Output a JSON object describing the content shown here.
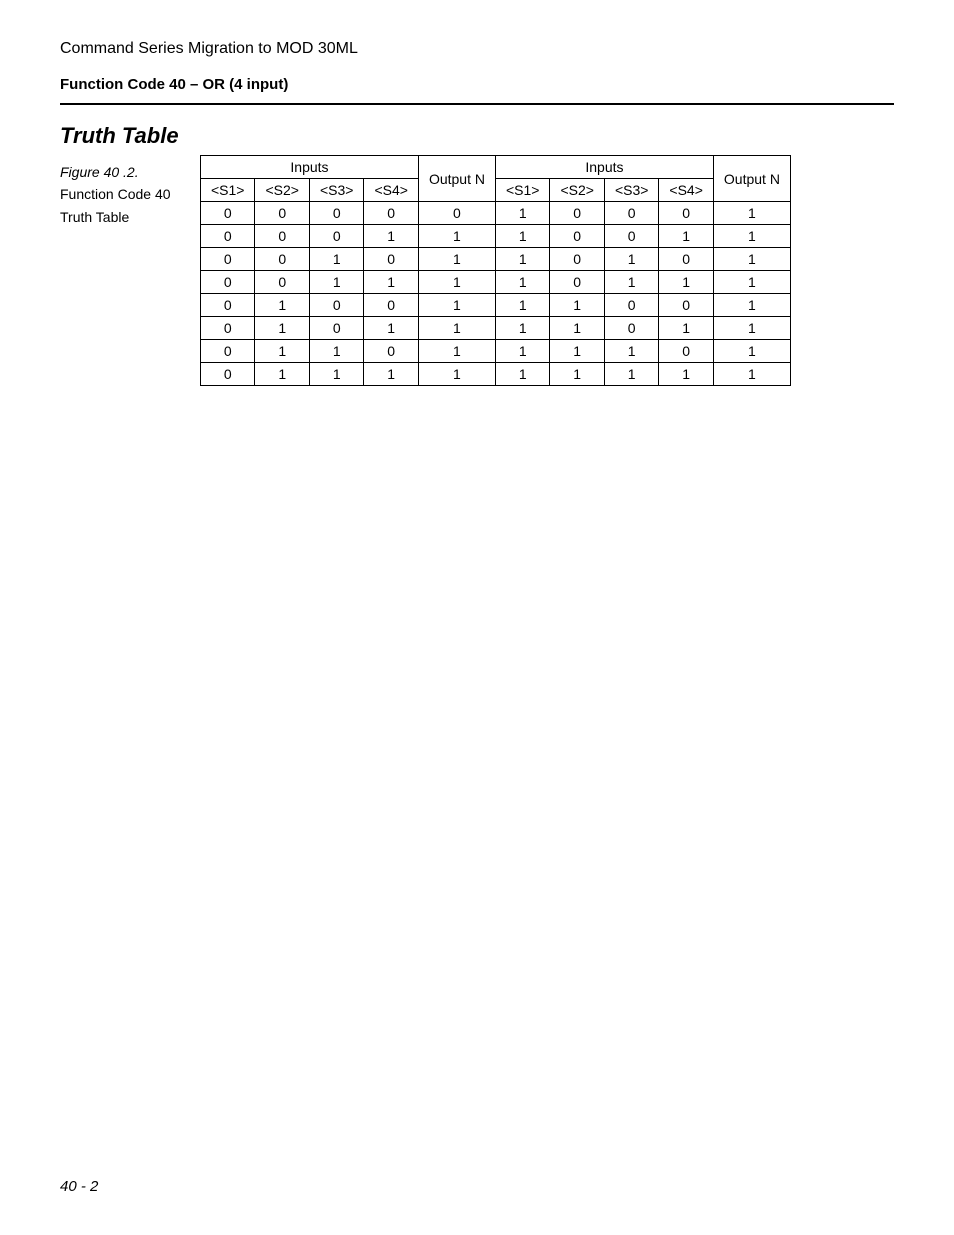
{
  "header": {
    "title": "Command Series Migration to MOD 30ML",
    "subtitle": "Function Code 40 – OR (4 input)"
  },
  "section": {
    "title": "Truth Table"
  },
  "figure": {
    "label": "Figure 40 .2.",
    "line1": "Function Code 40",
    "line2": "Truth Table"
  },
  "table": {
    "inputs_header": "Inputs",
    "output_header": "Output N",
    "sub_headers": [
      "<S1>",
      "<S2>",
      "<S3>",
      "<S4>"
    ],
    "rows_left": [
      [
        "0",
        "0",
        "0",
        "0",
        "0"
      ],
      [
        "0",
        "0",
        "0",
        "1",
        "1"
      ],
      [
        "0",
        "0",
        "1",
        "0",
        "1"
      ],
      [
        "0",
        "0",
        "1",
        "1",
        "1"
      ],
      [
        "0",
        "1",
        "0",
        "0",
        "1"
      ],
      [
        "0",
        "1",
        "0",
        "1",
        "1"
      ],
      [
        "0",
        "1",
        "1",
        "0",
        "1"
      ],
      [
        "0",
        "1",
        "1",
        "1",
        "1"
      ]
    ],
    "rows_right": [
      [
        "1",
        "0",
        "0",
        "0",
        "1"
      ],
      [
        "1",
        "0",
        "0",
        "1",
        "1"
      ],
      [
        "1",
        "0",
        "1",
        "0",
        "1"
      ],
      [
        "1",
        "0",
        "1",
        "1",
        "1"
      ],
      [
        "1",
        "1",
        "0",
        "0",
        "1"
      ],
      [
        "1",
        "1",
        "0",
        "1",
        "1"
      ],
      [
        "1",
        "1",
        "1",
        "0",
        "1"
      ],
      [
        "1",
        "1",
        "1",
        "1",
        "1"
      ]
    ]
  },
  "footer": {
    "page": "40 - 2"
  }
}
